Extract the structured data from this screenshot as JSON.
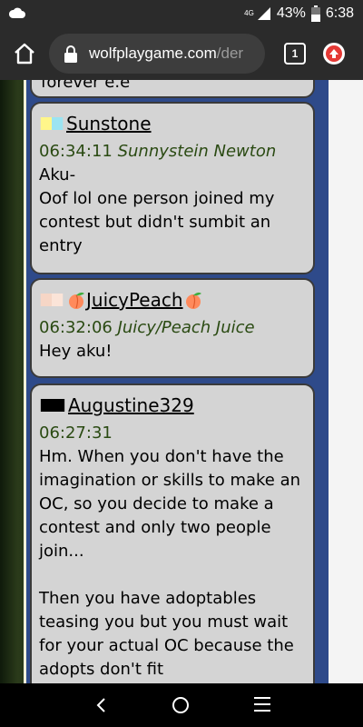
{
  "status_bar": {
    "network": "4G",
    "battery": "43%",
    "time": "6:38"
  },
  "browser": {
    "url_host": "wolfplaygame.com",
    "url_path": "/der",
    "tab_count": "1"
  },
  "chat": {
    "previous_tail": "forever e.e",
    "messages": [
      {
        "username": "Sunstone",
        "time": "06:34:11",
        "nickname": "Sunnystein Newton",
        "text": "Aku-\nOof lol one person joined my contest but didn't sumbit an entry",
        "flag_colors": [
          "#fff68a",
          "#9be4f2"
        ]
      },
      {
        "username": "JuicyPeach",
        "time": "06:32:06",
        "nickname": "Juicy/Peach Juice",
        "text": "Hey aku!",
        "flag_colors": [
          "#f6d6c6",
          "#fbe4d8"
        ]
      },
      {
        "username": "Augustine329",
        "time": "06:27:31",
        "nickname": "",
        "text": "Hm. When you don't have the imagination or skills to make an OC, so you decide to make a contest and only two people join...\n\nThen you have adoptables teasing you but you must wait for your actual OC because the adopts don't fit",
        "flag_colors": [
          "#000000",
          "#000000"
        ]
      }
    ]
  },
  "colors": {
    "timestamp": "#2a4a12",
    "bubble_bg": "#d4d4d4",
    "frame_blue": "#2e4a8a"
  }
}
